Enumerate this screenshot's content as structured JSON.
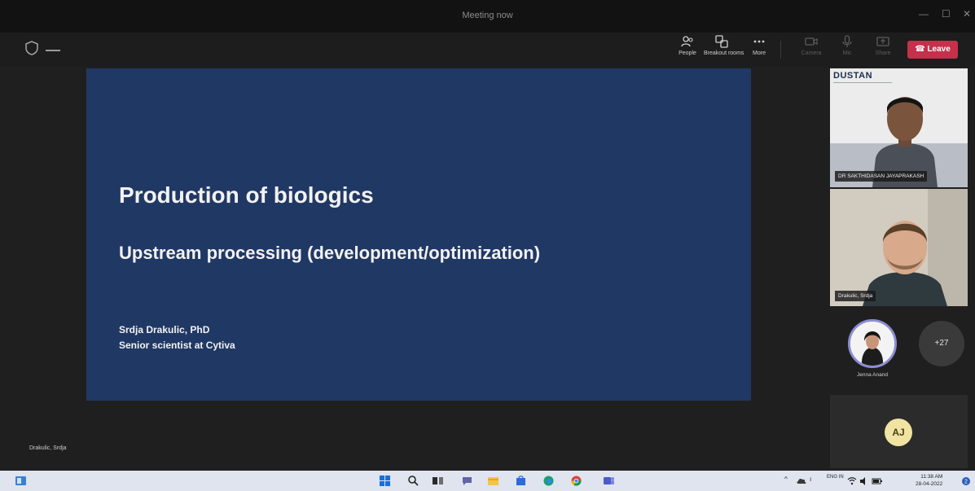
{
  "window": {
    "title": "Meeting now",
    "controls": [
      "—",
      "☐",
      "✕"
    ]
  },
  "toolbar": {
    "buttons": [
      {
        "id": "people",
        "label": "People",
        "icon": "people-icon",
        "enabled": true
      },
      {
        "id": "breakout",
        "label": "Breakout rooms",
        "icon": "breakout-rooms-icon",
        "enabled": true
      },
      {
        "id": "more",
        "label": "More",
        "icon": "more-icon",
        "enabled": true
      },
      {
        "id": "camera",
        "label": "Camera",
        "icon": "camera-off-icon",
        "enabled": false
      },
      {
        "id": "mic",
        "label": "Mic",
        "icon": "mic-off-icon",
        "enabled": false
      },
      {
        "id": "share",
        "label": "Share",
        "icon": "share-icon",
        "enabled": false
      }
    ],
    "leave_label": "Leave",
    "leave_color": "#c4314b"
  },
  "slide": {
    "title": "Production of biologics",
    "subtitle": "Upstream processing (development/optimization)",
    "author": "Srdja Drakulic, PhD",
    "role": "Senior scientist at Cytiva",
    "bg_color": "#203864"
  },
  "presenter_name": "Drakulic, Srdja",
  "participants": {
    "tile1": {
      "banner": "DUSTAN",
      "name": "DR SAKTHIDASAN JAYAPRAKASH"
    },
    "tile2": {
      "name": "Drakulic, Srdja"
    },
    "tile3": {
      "name": "Jenna Anand"
    },
    "overflow": "+27",
    "tile4": {
      "initials": "AJ"
    }
  },
  "taskbar": {
    "tray": {
      "lang": "ENG IN",
      "time": "11:38 AM",
      "date": "28-04-2022"
    }
  }
}
